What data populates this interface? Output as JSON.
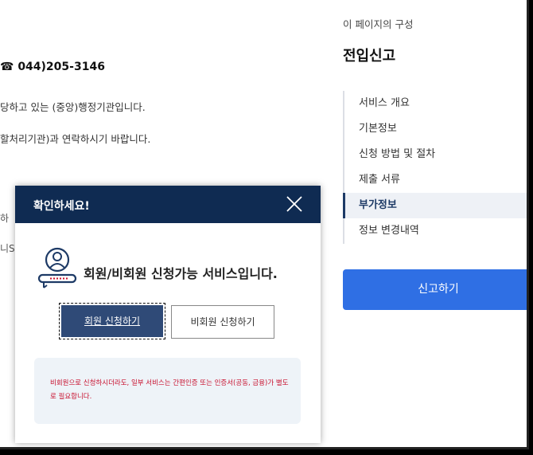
{
  "background": {
    "phone": "☎ 044)205-3146",
    "line1": "당하고 있는 (중앙)행정기관입니다.",
    "line2": "할처리기관)과 연락하시기 바랍니다.",
    "frag1": "하",
    "frag2": "니S"
  },
  "toc": {
    "caption": "이 페이지의 구성",
    "title": "전입신고",
    "items": [
      {
        "label": "서비스 개요"
      },
      {
        "label": "기본정보"
      },
      {
        "label": "신청 방법 및 절차"
      },
      {
        "label": "제출 서류"
      },
      {
        "label": "부가정보",
        "active": true
      },
      {
        "label": "정보 변경내역"
      }
    ],
    "report_button": "신고하기"
  },
  "modal": {
    "title": "확인하세요!",
    "message": "회원/비회원 신청가능 서비스입니다.",
    "member_button": "회원 신청하기",
    "guest_button": "비회원 신청하기",
    "notice": "비회원으로 신청하시더라도, 일부 서비스는 간편인증 또는 인증서(공동, 금융)가 별도로 필요합니다."
  },
  "colors": {
    "header_navy": "#0f2b52",
    "primary_blue": "#2f6fe4",
    "notice_red": "#c8102e"
  }
}
